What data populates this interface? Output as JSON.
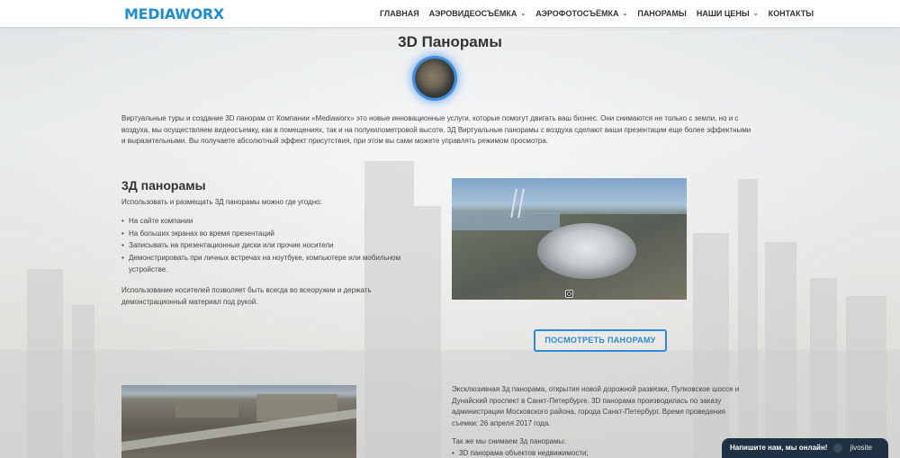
{
  "header": {
    "logo": "MEDIAWORX",
    "nav": [
      {
        "label": "ГЛАВНАЯ",
        "dropdown": false
      },
      {
        "label": "АЭРОВИДЕОСЪЁМКА",
        "dropdown": true
      },
      {
        "label": "АЭРОФОТОСЪЁМКА",
        "dropdown": true
      },
      {
        "label": "ПАНОРАМЫ",
        "dropdown": false
      },
      {
        "label": "НАШИ ЦЕНЫ",
        "dropdown": true
      },
      {
        "label": "КОНТАКТЫ",
        "dropdown": false
      }
    ],
    "dropdown_glyph": "⌄"
  },
  "main": {
    "title": "3D Панорамы",
    "intro": "Виртуальные туры и создание 3D панорам от Компании «Mediaworx» это новые инновационные услуги, которые помогут двигать ваш бизнес. Они снимаются не только с земли, но и с воздуха, мы осуществляем видеосъемку, как в помещениях, так и на полукилометровой высоте. 3Д Виртуальные панорамы с воздуха сделают ваши презентации еще более эффектными и выразительными. Вы получаете абсолютный эффект присутствия, при этом вы сами можете управлять режимом просмотра.",
    "section_title": "3Д панорамы",
    "section_lead": "Использовать и размещать 3Д панорамы можно где угодно:",
    "uses": [
      "На сайте компании",
      "На больших экранах во время презентаций",
      "Записывать на презентационные диски или прочие носители",
      "Демонстрировать при личных встречах на ноутбуке, компьютере или мобильном устройстве."
    ],
    "section_note": "Использование носителей позволяет быть всегда во всеоружии и держать демонстрационный материал под рукой.",
    "view_button": "ПОСМОТРЕТЬ ПАНОРАМУ",
    "panorama_desc": "Эксклюзивная 3д панорама, открытия новой дорожной развязки, Пулковское шоссе и Дунайский проспект в Санкт-Петербурге. 3D панорама производилась по заказу администрации Московского района, города Санкт-Петербург. Время проведения съемки: 26 апреля 2017 года.",
    "also_title": "Так же мы снимаем 3д панорамы:",
    "also_items": [
      "3D панорама объектов недвижимости;"
    ]
  },
  "chat": {
    "label": "Напишите нам, мы онлайн!",
    "brand": "jivosite"
  },
  "colors": {
    "brand": "#1e8fd6",
    "button": "#2e8ad8",
    "chat_bg": "#1f3142"
  },
  "icons": {
    "orb": "panorama-sphere-icon",
    "dropdown": "chevron-down-icon",
    "pano_control": "panorama-control-icon"
  }
}
